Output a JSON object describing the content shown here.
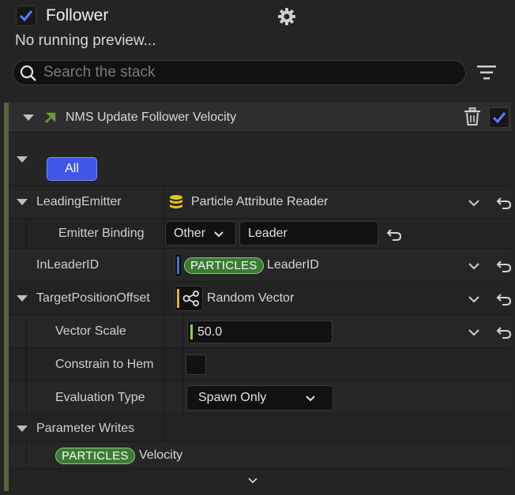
{
  "header": {
    "enabled": true,
    "title": "Follower",
    "subtitle": "No running preview...",
    "search_placeholder": "Search the stack"
  },
  "module": {
    "title": "NMS Update Follower Velocity",
    "enabled": true,
    "filter_label": "All",
    "accent_color": "#55663a",
    "filter_color": "#3f56e8"
  },
  "params": {
    "leading_emitter": {
      "label": "LeadingEmitter",
      "value": "Particle Attribute Reader"
    },
    "emitter_binding": {
      "label": "Emitter Binding",
      "mode": "Other",
      "value": "Leader"
    },
    "in_leader_id": {
      "label": "InLeaderID",
      "namespace": "PARTICLES",
      "value": "LeaderID"
    },
    "target_position_offset": {
      "label": "TargetPositionOffset",
      "value": "Random Vector"
    },
    "vector_scale": {
      "label": "Vector Scale",
      "value": "50.0"
    },
    "constrain": {
      "label": "Constrain to Hem",
      "checked": false
    },
    "evaluation_type": {
      "label": "Evaluation Type",
      "value": "Spawn Only"
    },
    "parameter_writes": {
      "label": "Parameter Writes"
    },
    "velocity": {
      "namespace": "PARTICLES",
      "value": "Velocity"
    }
  }
}
